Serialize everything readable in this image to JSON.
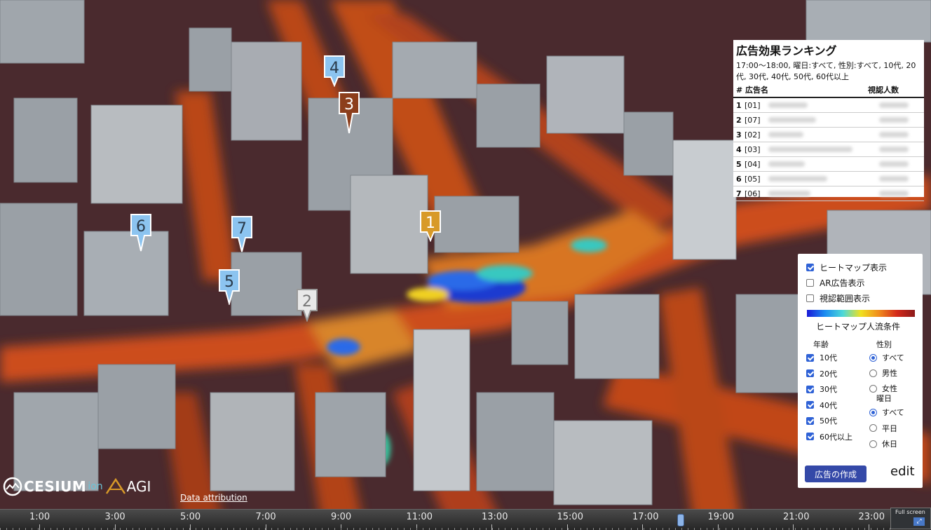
{
  "ranking": {
    "title": "広告効果ランキング",
    "conditions": "17:00～18:00, 曜日:すべて, 性別:すべて, 10代, 20代, 30代, 40代, 50代, 60代以上",
    "col_name": "# 広告名",
    "col_viewers": "視認人数",
    "rows": [
      {
        "rank": "1",
        "code": "[01]"
      },
      {
        "rank": "2",
        "code": "[07]"
      },
      {
        "rank": "3",
        "code": "[02]"
      },
      {
        "rank": "4",
        "code": "[03]"
      },
      {
        "rank": "5",
        "code": "[04]"
      },
      {
        "rank": "6",
        "code": "[05]"
      },
      {
        "rank": "7",
        "code": "[06]"
      }
    ]
  },
  "controls": {
    "heatmap_label": "ヒートマップ表示",
    "ar_label": "AR広告表示",
    "view_range_label": "視認範囲表示",
    "heatmap_on": true,
    "ar_on": false,
    "view_range_on": false,
    "flow_title": "ヒートマップ人流条件",
    "age_title": "年齢",
    "gender_title": "性別",
    "day_title": "曜日",
    "ages": [
      {
        "label": "10代",
        "on": true
      },
      {
        "label": "20代",
        "on": true
      },
      {
        "label": "30代",
        "on": true
      },
      {
        "label": "40代",
        "on": true
      },
      {
        "label": "50代",
        "on": true
      },
      {
        "label": "60代以上",
        "on": true
      }
    ],
    "genders": [
      {
        "label": "すべて",
        "on": true
      },
      {
        "label": "男性",
        "on": false
      },
      {
        "label": "女性",
        "on": false
      }
    ],
    "days": [
      {
        "label": "すべて",
        "on": true
      },
      {
        "label": "平日",
        "on": false
      },
      {
        "label": "休日",
        "on": false
      }
    ],
    "create_button": "広告の作成",
    "edit_label": "edit"
  },
  "markers": [
    {
      "label": "1",
      "color": "#d89a28"
    },
    {
      "label": "2",
      "color": "#e8e8e8"
    },
    {
      "label": "3",
      "color": "#8c3e1c"
    },
    {
      "label": "4",
      "color": "#8cc4f0"
    },
    {
      "label": "5",
      "color": "#8cc4f0"
    },
    {
      "label": "6",
      "color": "#8cc4f0"
    },
    {
      "label": "7",
      "color": "#8cc4f0"
    }
  ],
  "logo": {
    "cesium": "CESIUM",
    "ion": "ion",
    "agi": "AGI"
  },
  "attribution": "Data attribution",
  "timeline": {
    "labels": [
      "1:00",
      "3:00",
      "5:00",
      "7:00",
      "9:00",
      "11:00",
      "13:00",
      "15:00",
      "17:00",
      "19:00",
      "21:00",
      "23:00"
    ]
  },
  "fullscreen_label": "Full screen",
  "colors": {
    "accent": "#3449a8",
    "checkbox": "#2f62d6"
  }
}
